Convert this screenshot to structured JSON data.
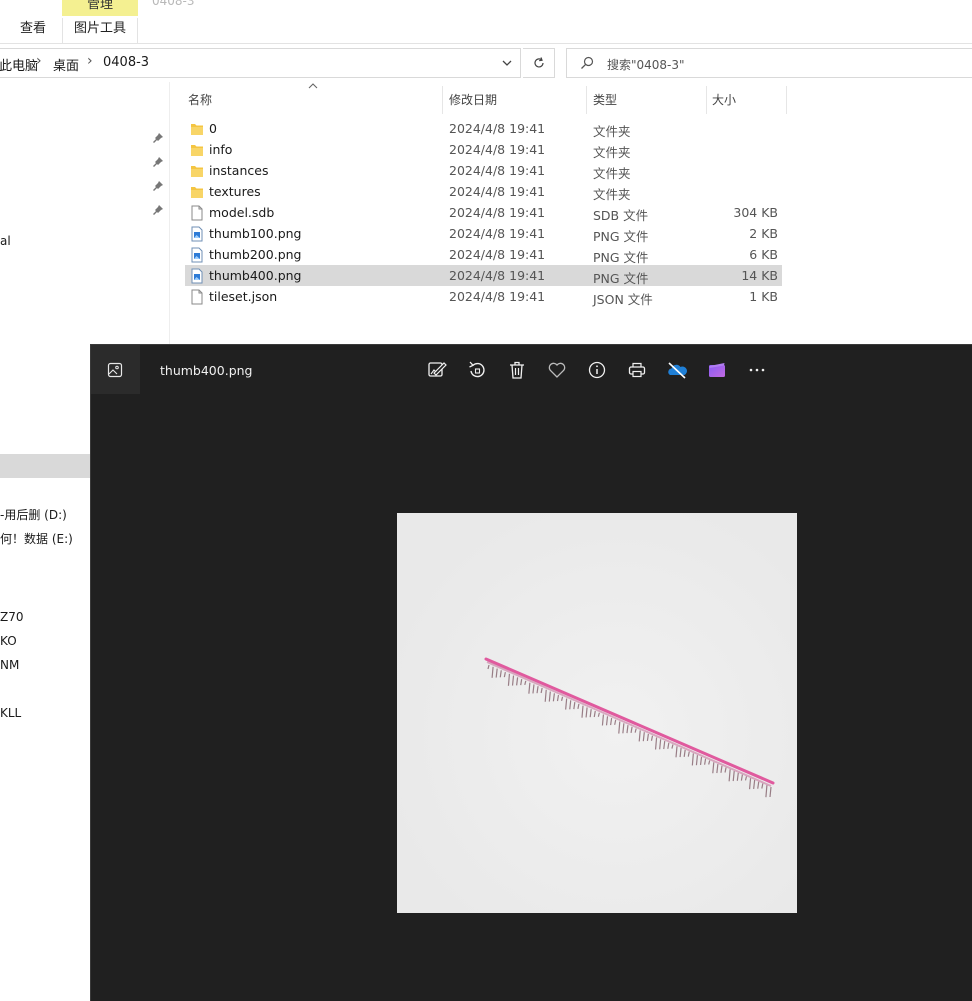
{
  "ribbon": {
    "context_tab": "管理",
    "folder_title": "0408-3",
    "tabs": [
      "查看",
      "图片工具"
    ]
  },
  "address": {
    "crumbs": [
      "此电脑",
      "桌面",
      "0408-3"
    ],
    "refresh_icon": "refresh-icon",
    "search_placeholder": "搜索\"0408-3\""
  },
  "nav": {
    "items": [
      "al",
      "-用后删 (D:)",
      "何！数据 (E:)",
      "Z70",
      "KO",
      "NM",
      "KLL"
    ]
  },
  "file_list": {
    "columns": {
      "name": "名称",
      "date": "修改日期",
      "type": "类型",
      "size": "大小"
    },
    "rows": [
      {
        "name": "0",
        "date": "2024/4/8 19:41",
        "type": "文件夹",
        "size": "",
        "icon": "folder-icon"
      },
      {
        "name": "info",
        "date": "2024/4/8 19:41",
        "type": "文件夹",
        "size": "",
        "icon": "folder-icon"
      },
      {
        "name": "instances",
        "date": "2024/4/8 19:41",
        "type": "文件夹",
        "size": "",
        "icon": "folder-icon"
      },
      {
        "name": "textures",
        "date": "2024/4/8 19:41",
        "type": "文件夹",
        "size": "",
        "icon": "folder-icon"
      },
      {
        "name": "model.sdb",
        "date": "2024/4/8 19:41",
        "type": "SDB 文件",
        "size": "304 KB",
        "icon": "file-icon"
      },
      {
        "name": "thumb100.png",
        "date": "2024/4/8 19:41",
        "type": "PNG 文件",
        "size": "2 KB",
        "icon": "image-file-icon"
      },
      {
        "name": "thumb200.png",
        "date": "2024/4/8 19:41",
        "type": "PNG 文件",
        "size": "6 KB",
        "icon": "image-file-icon"
      },
      {
        "name": "thumb400.png",
        "date": "2024/4/8 19:41",
        "type": "PNG 文件",
        "size": "14 KB",
        "icon": "image-file-icon",
        "selected": true
      },
      {
        "name": "tileset.json",
        "date": "2024/4/8 19:41",
        "type": "JSON 文件",
        "size": "1 KB",
        "icon": "file-icon"
      }
    ]
  },
  "viewer": {
    "title": "thumb400.png",
    "toolbar_icons": [
      "edit-image-icon",
      "rotate-icon",
      "delete-icon",
      "favorite-icon",
      "info-icon",
      "print-icon",
      "onedrive-icon",
      "clipchamp-icon",
      "more-icon"
    ],
    "colors": {
      "background": "#202020",
      "photo_background": "#ececec",
      "model_pink": "#e05a9e"
    }
  }
}
